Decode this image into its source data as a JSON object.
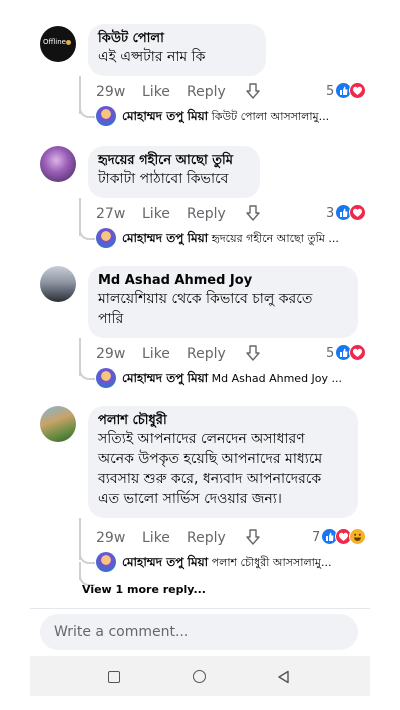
{
  "comments": [
    {
      "author": "কিউট পোলা",
      "avatar_text": "Offline",
      "text": "এই এপ্সটার নাম কি",
      "time": "29w",
      "like_label": "Like",
      "reply_label": "Reply",
      "reaction_count": "5",
      "reply_preview": {
        "name": "মোহাম্মদ তপু মিয়া",
        "text": "কিউট পোলা আসসালামু..."
      }
    },
    {
      "author": "হৃদয়ের গহীনে আছো তুমি",
      "text": "টাকাটা পাঠাবো কিভাবে",
      "time": "27w",
      "like_label": "Like",
      "reply_label": "Reply",
      "reaction_count": "3",
      "reply_preview": {
        "name": "মোহাম্মদ তপু মিয়া",
        "text": "হৃদয়ের গহীনে আছো তুমি ..."
      }
    },
    {
      "author": "Md Ashad Ahmed Joy",
      "text_lines": [
        "মালয়েশিয়ায় থেকে কিভাবে চালু করতে",
        "পারি"
      ],
      "time": "29w",
      "like_label": "Like",
      "reply_label": "Reply",
      "reaction_count": "5",
      "reply_preview": {
        "name": "মোহাম্মদ তপু মিয়া",
        "text": "Md Ashad Ahmed Joy ..."
      }
    },
    {
      "author": "পলাশ চৌধুরী",
      "text_lines": [
        "সত্যিই আপনাদের লেনদেন অসাধারণ",
        "অনেক উপকৃত হয়েছি আপনাদের মাধ্যমে",
        "ব্যবসায় শুরু করে, ধন্যবাদ আপনাদেরকে",
        "এত ভালো সার্ভিস দেওয়ার জন্য।"
      ],
      "time": "29w",
      "like_label": "Like",
      "reply_label": "Reply",
      "reaction_count": "7",
      "reply_preview": {
        "name": "মোহাম্মদ তপু মিয়া",
        "text": "পলাশ চৌধুরী আসসালামু..."
      },
      "view_more": "View 1 more reply..."
    }
  ],
  "composer": {
    "placeholder": "Write a comment..."
  },
  "icons": {
    "download": "download-arrow-icon",
    "like_reaction": "like-reaction-icon",
    "love_reaction": "love-reaction-icon",
    "haha_reaction": "haha-reaction-icon",
    "nav_square": "recent-apps-icon",
    "nav_circle": "home-icon",
    "nav_triangle": "back-icon"
  },
  "colors": {
    "like": "#1877f2",
    "love": "#f02849",
    "haha": "#f7b125",
    "bubble": "#f0f2f5",
    "meta": "#65676b"
  }
}
